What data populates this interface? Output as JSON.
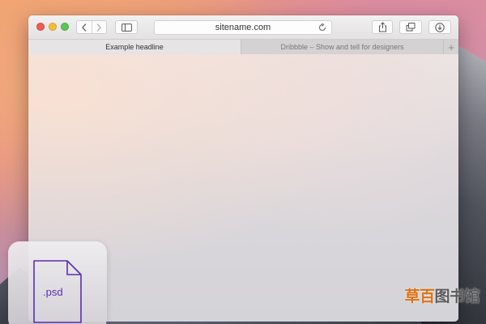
{
  "colors": {
    "close": "#ec5f57",
    "minimize": "#f0be3b",
    "maximize": "#5dc554",
    "psd_accent": "#5a2db3",
    "watermark_orange": "#e07012",
    "watermark_gray": "#5a5a5a"
  },
  "toolbar": {
    "back_icon": "chevron-left-icon",
    "forward_icon": "chevron-right-icon",
    "sidebar_icon": "sidebar-icon",
    "url": "sitename.com",
    "reload_icon": "reload-icon",
    "share_icon": "share-icon",
    "tabs_icon": "tabs-overview-icon",
    "download_icon": "download-icon"
  },
  "tabs": [
    {
      "label": "Example headline",
      "active": true
    },
    {
      "label": "Dribbble – Show and tell for designers",
      "active": false
    }
  ],
  "new_tab_label": "+",
  "desktop_icon": {
    "label": ".psd",
    "icon": "document-icon"
  },
  "watermark": {
    "part1": "草百",
    "part2": "图书馆"
  }
}
